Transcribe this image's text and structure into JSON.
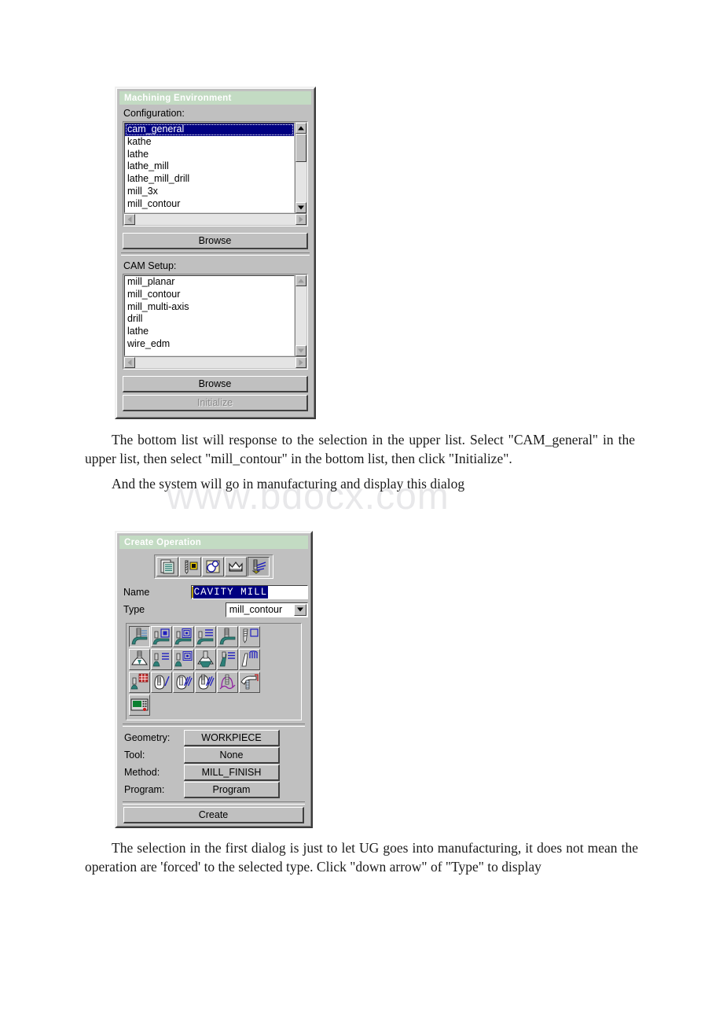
{
  "watermark": "www.bdocx.com",
  "paragraphs": {
    "p1": "The bottom list will response to the selection in the upper list. Select \"CAM_general\" in the upper list, then select \"mill_contour\" in the bottom list, then click \"Initialize\".",
    "p2": "And the system will go in manufacturing and display this dialog",
    "p3": "The selection in the first dialog is just to let UG goes into manufacturing, it does not mean the operation are 'forced' to the selected type. Click \"down arrow\" of \"Type\" to display"
  },
  "machining_environment": {
    "title": "Machining Environment",
    "configuration_label": "Configuration:",
    "configuration_items": [
      "cam_general",
      "kathe",
      "lathe",
      "lathe_mill",
      "lathe_mill_drill",
      "mill_3x",
      "mill_contour"
    ],
    "configuration_selected": "cam_general",
    "browse_top_label": "Browse",
    "cam_setup_label": "CAM Setup:",
    "cam_setup_items": [
      "mill_planar",
      "mill_contour",
      "mill_multi-axis",
      "drill",
      "lathe",
      "wire_edm"
    ],
    "browse_bottom_label": "Browse",
    "initialize_label": "Initialize",
    "initialize_enabled": false
  },
  "create_operation": {
    "title": "Create Operation",
    "toolbar_icons": [
      "program-icon",
      "tool-icon",
      "geometry-icon",
      "method-icon",
      "operation-icon"
    ],
    "toolbar_active_index": 4,
    "name_label": "Name",
    "name_value": "CAVITY MILL",
    "type_label": "Type",
    "type_value": "mill_contour",
    "operation_icons": [
      "cavity-mill-icon",
      "zlevel-profile-icon",
      "zlevel-corner-icon",
      "zlevel-follow-core-icon",
      "plunge-mill-icon",
      "contour-area-nonsteep-icon",
      "fixed-contour-icon",
      "contour-area-icon",
      "contour-surface-area-icon",
      "flowcut-single-icon",
      "contour-profile-icon",
      "contour-text-icon",
      "profile-3d-icon",
      "flowcut-ref-tool-icon",
      "flowcut-multiple-icon",
      "flowcut-smooth-icon",
      "variable-contour-icon",
      "sequential-mill-icon",
      "mill-user-defined-icon"
    ],
    "operation_active_index": 0,
    "params": [
      {
        "label": "Geometry:",
        "value": "WORKPIECE"
      },
      {
        "label": "Tool:",
        "value": "None"
      },
      {
        "label": "Method:",
        "value": "MILL_FINISH"
      },
      {
        "label": "Program:",
        "value": "Program"
      }
    ],
    "create_label": "Create"
  },
  "colors": {
    "titlebar": "#c3dbc3",
    "dialog_face": "#c0c0c0",
    "selection": "#000080",
    "watermark": "#e8e8ea"
  }
}
